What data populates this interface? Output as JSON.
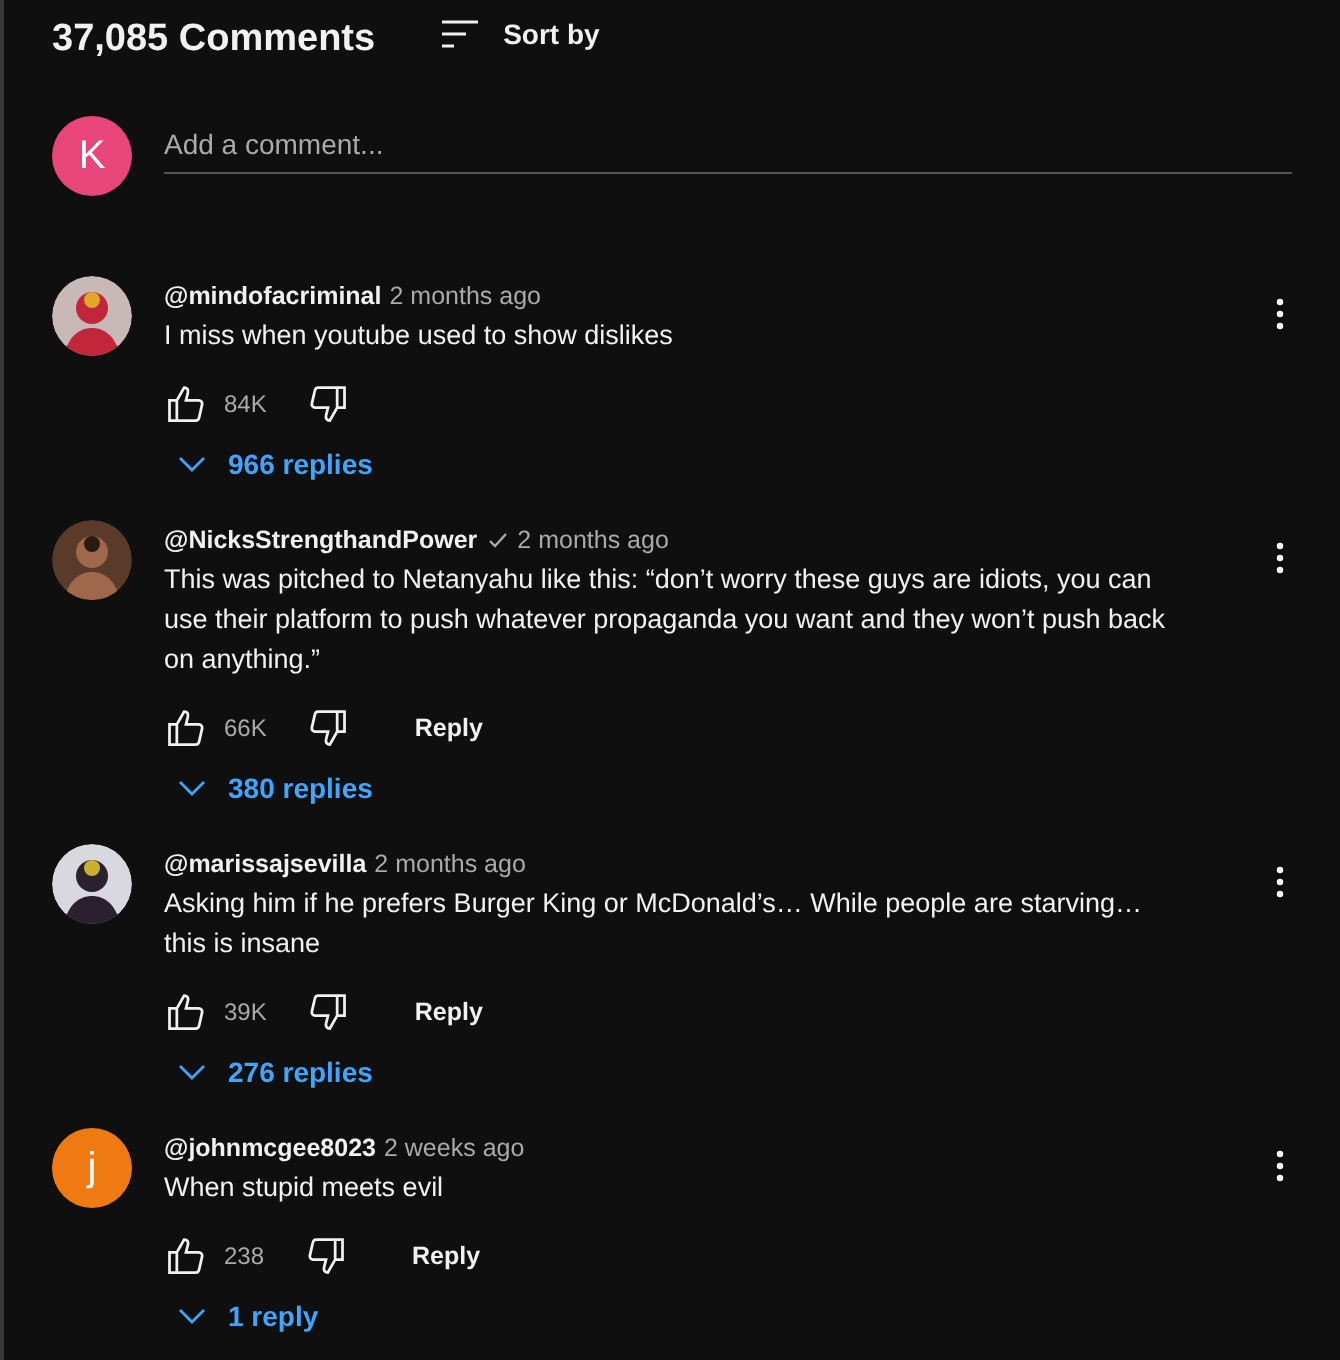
{
  "header": {
    "count": "37,085 Comments",
    "sort_label": "Sort by"
  },
  "composer": {
    "avatar": {
      "letter": "K",
      "color": "#e8457a"
    },
    "placeholder": "Add a comment..."
  },
  "comments": [
    {
      "author": "@mindofacriminal",
      "verified": false,
      "time": "2 months ago",
      "text": "I miss when youtube used to show dislikes",
      "likes": "84K",
      "replies": "966 replies"
    },
    {
      "author": "@NicksStrengthandPower",
      "verified": true,
      "time": "2 months ago",
      "text": "This was pitched to Netanyahu like this: “don’t worry these guys are idiots, you can use their platform to push whatever propaganda you want and they won’t push back on anything.”",
      "likes": "66K",
      "reply": "Reply",
      "replies": "380 replies"
    },
    {
      "author": "@marissajsevilla",
      "verified": false,
      "time": "2 months ago",
      "text": "Asking him if he prefers Burger King or McDonald’s… While people are starving… this is insane",
      "likes": "39K",
      "reply": "Reply",
      "replies": "276 replies"
    },
    {
      "avatar": {
        "kind": "letter",
        "letter": "j",
        "color": "#ef7a12"
      },
      "author": "@johnmcgee8023",
      "verified": false,
      "time": "2 weeks ago",
      "text": "When stupid meets evil",
      "likes": "238",
      "reply": "Reply",
      "replies": "1 reply"
    }
  ]
}
